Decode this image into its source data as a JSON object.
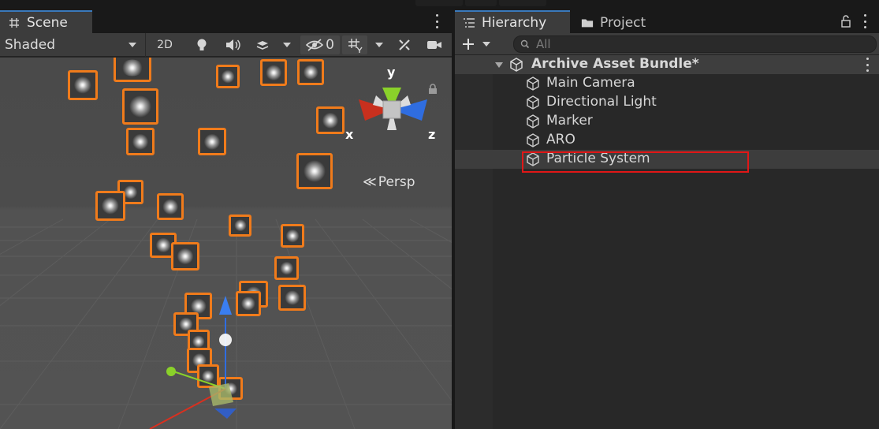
{
  "scene_panel": {
    "tab_label": "Scene",
    "shading_mode": "Shaded",
    "toggle_2d": "2D",
    "hidden_count": "0",
    "persp_label": "Persp",
    "gizmo": {
      "x_label": "x",
      "y_label": "y",
      "z_label": "z"
    }
  },
  "hierarchy_panel": {
    "tab_hierarchy": "Hierarchy",
    "tab_project": "Project",
    "search_placeholder": "All",
    "root": {
      "label": "Archive Asset Bundle*"
    },
    "items": [
      {
        "label": "Main Camera"
      },
      {
        "label": "Directional Light"
      },
      {
        "label": "Marker"
      },
      {
        "label": "ARO"
      },
      {
        "label": "Particle System"
      }
    ]
  },
  "colors": {
    "accent_tab": "#3a79bb",
    "particle_outline": "#f07b1b",
    "annotation_box": "#e01717",
    "axis_x": "#d9301f",
    "axis_y": "#8ad12a",
    "axis_z": "#2f6de0"
  }
}
